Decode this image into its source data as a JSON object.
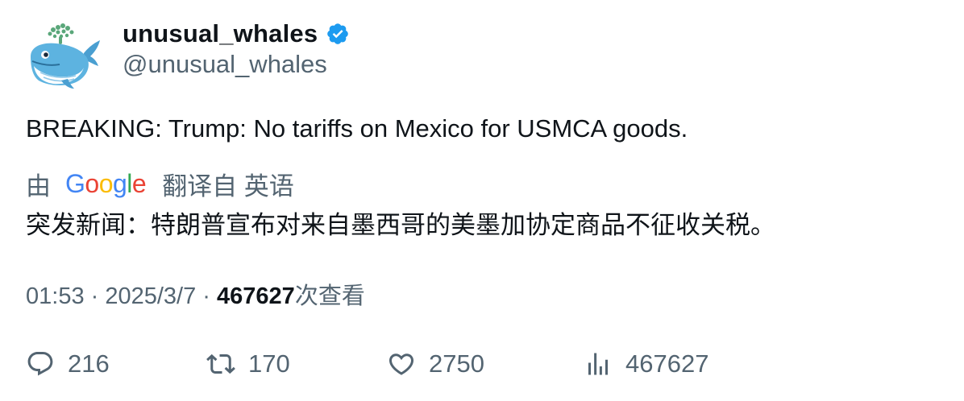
{
  "author": {
    "display_name": "unusual_whales",
    "handle": "@unusual_whales",
    "verified": true,
    "verified_color": "#1d9bf0",
    "avatar_icon": "whale-icon"
  },
  "tweet": {
    "text": "BREAKING: Trump: No tariffs on Mexico for USMCA goods."
  },
  "translation": {
    "by_label": "由",
    "provider": "Google",
    "translated_from_label": "翻译自 英语",
    "text": "突发新闻：特朗普宣布对来自墨西哥的美墨加协定商品不征收关税。"
  },
  "meta": {
    "time": "01:53",
    "separator": " · ",
    "date": "2025/3/7",
    "views_count": "467627",
    "views_label": "次查看"
  },
  "actions": {
    "replies": "216",
    "retweets": "170",
    "likes": "2750",
    "views": "467627"
  },
  "colors": {
    "text_primary": "#0f1419",
    "text_secondary": "#536471",
    "google_blue": "#4285F4",
    "google_red": "#EA4335",
    "google_yellow": "#FBBC05",
    "google_green": "#34A853"
  }
}
